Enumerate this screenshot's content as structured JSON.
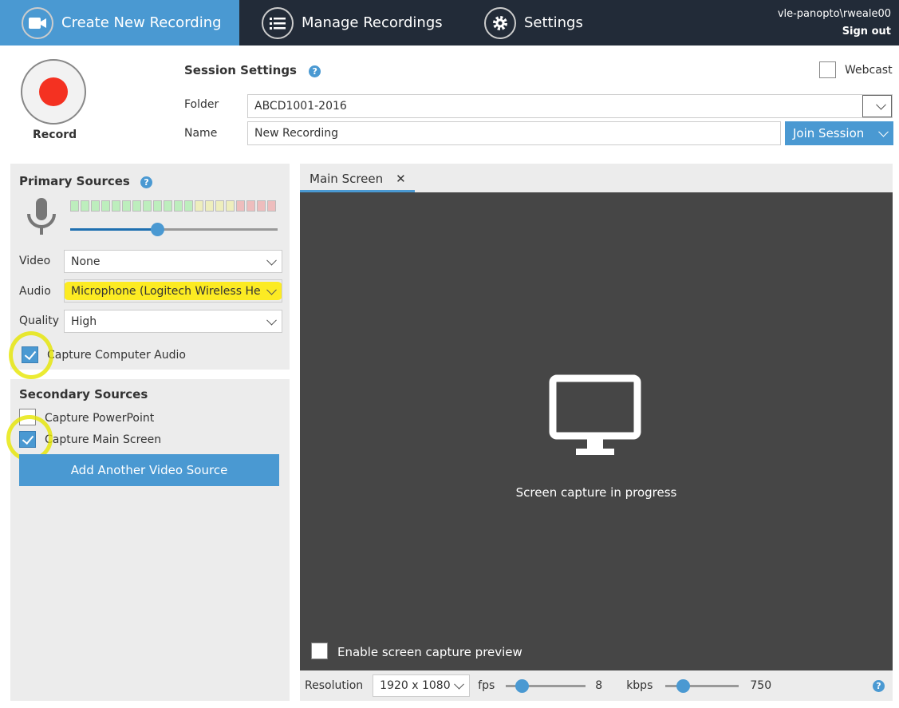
{
  "nav": {
    "tabs": [
      {
        "label": "Create New Recording",
        "icon": "video-camera-icon",
        "active": true
      },
      {
        "label": "Manage Recordings",
        "icon": "list-icon"
      },
      {
        "label": "Settings",
        "icon": "gear-icon"
      }
    ],
    "user": "vle-panopto\\rweale00",
    "sign_out": "Sign out"
  },
  "record": {
    "label": "Record"
  },
  "session": {
    "title": "Session Settings",
    "webcast_label": "Webcast",
    "webcast_checked": false,
    "folder_label": "Folder",
    "folder_value": "ABCD1001-2016",
    "name_label": "Name",
    "name_value": "New Recording",
    "join_label": "Join Session"
  },
  "primary": {
    "title": "Primary Sources",
    "volume_percent": 42,
    "meter": {
      "green": 12,
      "yellow": 4,
      "red": 4
    },
    "video_label": "Video",
    "video_value": "None",
    "audio_label": "Audio",
    "audio_value": "Microphone (Logitech Wireless Headset)",
    "quality_label": "Quality",
    "quality_value": "High",
    "computer_audio_label": "Capture Computer Audio",
    "computer_audio_checked": true
  },
  "secondary": {
    "title": "Secondary Sources",
    "powerpoint_label": "Capture PowerPoint",
    "powerpoint_checked": false,
    "main_screen_label": "Capture Main Screen",
    "main_screen_checked": true,
    "add_source_label": "Add Another Video Source"
  },
  "preview": {
    "tab_label": "Main Screen",
    "status": "Screen capture in progress",
    "enable_preview_label": "Enable screen capture preview",
    "enable_preview_checked": false
  },
  "bottom": {
    "resolution_label": "Resolution",
    "resolution_value": "1920 x 1080",
    "fps_label": "fps",
    "fps_value": "8",
    "kbps_label": "kbps",
    "kbps_value": "750"
  },
  "colors": {
    "accent": "#4a99d2",
    "nav_bg": "#222b38",
    "record_red": "#f43121",
    "preview_bg": "#464646"
  }
}
